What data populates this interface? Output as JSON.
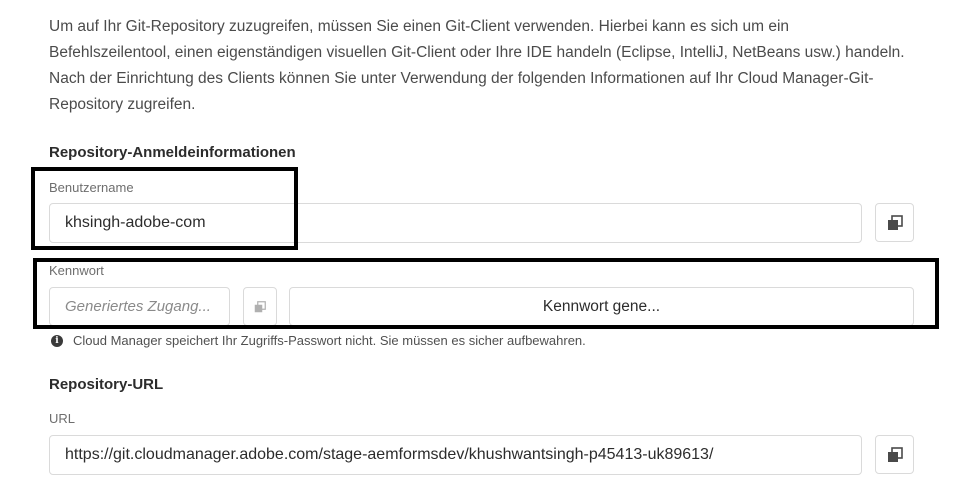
{
  "intro": {
    "line1": "Um auf Ihr Git-Repository zuzugreifen, müssen Sie einen Git-Client verwenden. Hierbei kann es sich um ein",
    "line2": "Befehlszeilentool, einen eigenständigen visuellen Git-Client oder Ihre IDE handeln (Eclipse, IntelliJ, NetBeans usw.) handeln.",
    "line3": "Nach der Einrichtung des Clients können Sie unter Verwendung der folgenden Informationen auf Ihr Cloud Manager-Git-",
    "line4": "Repository zugreifen."
  },
  "credentials": {
    "title": "Repository-Anmeldeinformationen",
    "username_label": "Benutzername",
    "username_value": "khsingh-adobe-com",
    "password_label": "Kennwort",
    "password_placeholder": "Generiertes Zugang...",
    "generate_button_label": "Kennwort gene...",
    "note": "Cloud Manager speichert Ihr Zugriffs-Passwort nicht. Sie müssen es sicher aufbewahren.",
    "note_icon": "info-icon"
  },
  "repository": {
    "title": "Repository-URL",
    "url_label": "URL",
    "url_value": "https://git.cloudmanager.adobe.com/stage-aemformsdev/khushwantsingh-p45413-uk89613/"
  },
  "icons": {
    "copy": "copy-icon"
  },
  "colors": {
    "highlight_border": "#000000",
    "field_border": "#dadada",
    "text": "#2c2c2c",
    "muted_text": "#6e6e6e"
  }
}
